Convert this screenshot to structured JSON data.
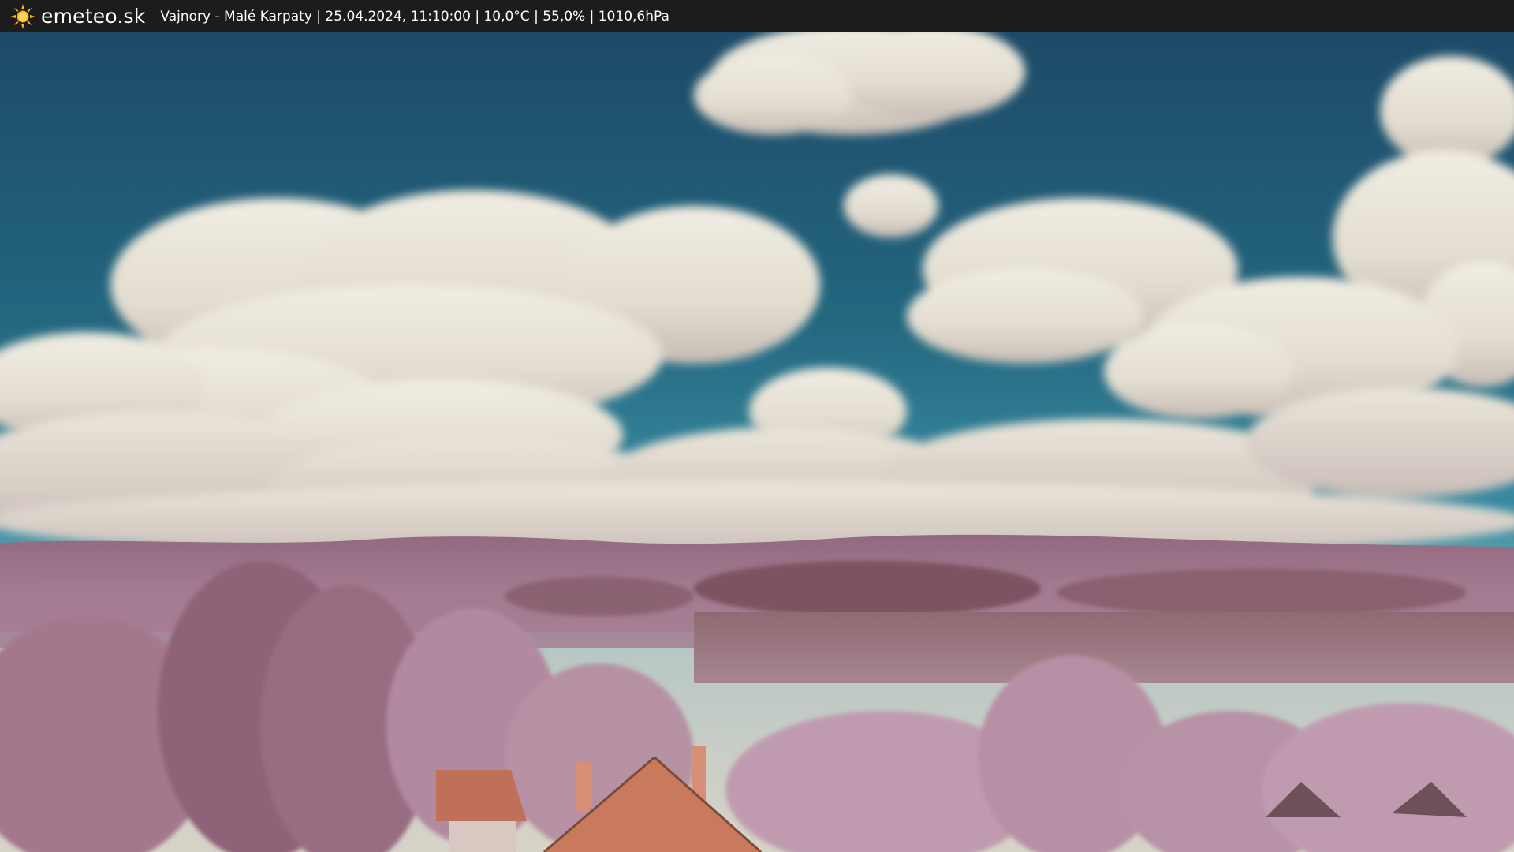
{
  "header": {
    "brand": "emeteo.sk",
    "info": "Vajnory - Malé Karpaty | 25.04.2024, 11:10:00 | 10,0°C | 55,0% | 1010,6hPa",
    "logo_icon": "sun-icon"
  },
  "colors": {
    "bar_background": "#1c1c1c",
    "sky_top": "#1f4f6e",
    "sky_mid": "#2a7a93",
    "cloud": "#e6e1d6",
    "foliage": "#a9788f",
    "hills": "#9e6f85",
    "roof": "#c97a5c"
  }
}
